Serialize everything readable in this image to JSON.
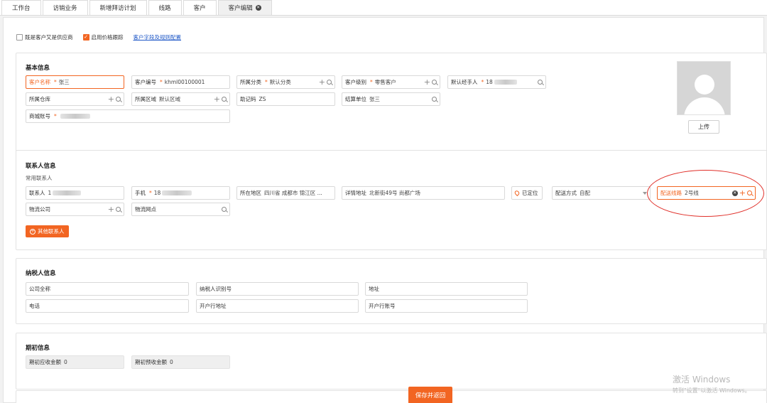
{
  "tabs": [
    {
      "label": "工作台"
    },
    {
      "label": "访销业务"
    },
    {
      "label": "新增拜访计划"
    },
    {
      "label": "线路"
    },
    {
      "label": "客户"
    },
    {
      "label": "客户编辑"
    }
  ],
  "options": {
    "both_customer_supplier": "既是客户又是供应商",
    "enable_price_tracking": "启用价格跟踪",
    "field_rule_config_link": "客户字段及规则配置"
  },
  "basic": {
    "title": "基本信息",
    "customer_name": {
      "label": "客户名称",
      "value": "张三"
    },
    "customer_code": {
      "label": "客户编号",
      "value": "khml00100001"
    },
    "category": {
      "label": "所属分类",
      "value": "默认分类"
    },
    "level": {
      "label": "客户级别",
      "value": "零售客户"
    },
    "manager": {
      "label": "默认经手人",
      "value": "18"
    },
    "warehouse": {
      "label": "所属仓库",
      "value": ""
    },
    "region": {
      "label": "所属区域",
      "value": "默认区域"
    },
    "mnemonic": {
      "label": "助记码",
      "value": "ZS"
    },
    "settlement": {
      "label": "结算单位",
      "value": "张三"
    },
    "mall_account": {
      "label": "商城账号",
      "value": ""
    },
    "upload_label": "上传"
  },
  "contact": {
    "title": "联系人信息",
    "subtitle": "常用联系人",
    "person": {
      "label": "联系人",
      "value": "1"
    },
    "phone": {
      "label": "手机",
      "value": "18"
    },
    "area": {
      "label": "所在地区",
      "value": "四川省 成都市 锦江区 ..."
    },
    "address": {
      "label": "详情地址",
      "value": "北新街49号 尚都广场"
    },
    "located_label": "已定位",
    "delivery_method": {
      "label": "配送方式",
      "value": "自配"
    },
    "delivery_route": {
      "label": "配送线路",
      "value": "2号线"
    },
    "logistics_company": {
      "label": "物流公司",
      "value": ""
    },
    "logistics_point": {
      "label": "物流网点",
      "value": ""
    },
    "other_contacts_label": "其他联系人"
  },
  "taxpayer": {
    "title": "纳税人信息",
    "company_name": "公司全称",
    "tax_id": "纳税人识别号",
    "address": "地址",
    "phone": "电话",
    "bank_address": "开户行地址",
    "bank_account": "开户行账号"
  },
  "initial": {
    "title": "期初信息",
    "receivable": {
      "label": "期初应收金额",
      "value": "0"
    },
    "prepaid": {
      "label": "期初预收金额",
      "value": "0"
    }
  },
  "footer": {
    "save_return": "保存并返回"
  },
  "watermark": {
    "line1": "激活 Windows",
    "line2": "转到\"设置\"以激活 Windows。"
  },
  "colors": {
    "accent": "#f26522",
    "highlight_circle": "#e0302a"
  }
}
